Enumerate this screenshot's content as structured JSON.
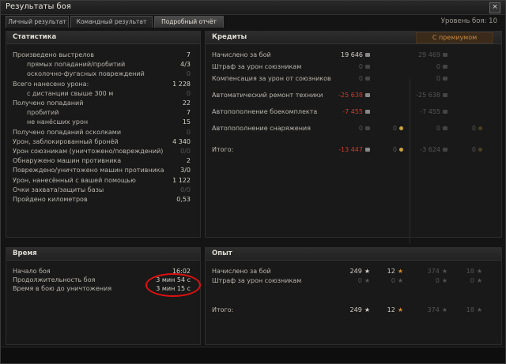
{
  "window": {
    "title": "Результаты боя",
    "close": "×"
  },
  "tabs": [
    {
      "label": "Личный результат"
    },
    {
      "label": "Командный результат"
    },
    {
      "label": "Подробный отчёт"
    }
  ],
  "level_label": "Уровень боя: 10",
  "stats": {
    "header": "Статистика",
    "rows": [
      {
        "label": "Произведено выстрелов",
        "value": "7",
        "indent": false,
        "dim": false
      },
      {
        "label": "прямых попаданий/пробитий",
        "value": "4/3",
        "indent": true,
        "dim": false
      },
      {
        "label": "осколочно-фугасных повреждений",
        "value": "0",
        "indent": true,
        "dim": true
      },
      {
        "label": "Всего нанесено урона:",
        "value": "1 228",
        "indent": false,
        "dim": false
      },
      {
        "label": "с дистанции свыше 300 м",
        "value": "0",
        "indent": true,
        "dim": true
      },
      {
        "label": "Получено попаданий",
        "value": "22",
        "indent": false,
        "dim": false
      },
      {
        "label": "пробитий",
        "value": "7",
        "indent": true,
        "dim": false
      },
      {
        "label": "не нанёсших урон",
        "value": "15",
        "indent": true,
        "dim": false
      },
      {
        "label": "Получено попаданий осколками",
        "value": "0",
        "indent": false,
        "dim": true
      },
      {
        "label": "Урон, заблокированный бронёй",
        "value": "4 340",
        "indent": false,
        "dim": false
      },
      {
        "label": "Урон союзникам (уничтожено/повреждений)",
        "value": "0/0",
        "indent": false,
        "dim": true
      },
      {
        "label": "Обнаружено машин противника",
        "value": "2",
        "indent": false,
        "dim": false
      },
      {
        "label": "Повреждено/уничтожено машин противника",
        "value": "3/0",
        "indent": false,
        "dim": false
      },
      {
        "label": "Урон, нанесённый с вашей помощью",
        "value": "1 122",
        "indent": false,
        "dim": false
      },
      {
        "label": "Очки захвата/защиты базы",
        "value": "0/0",
        "indent": false,
        "dim": true
      },
      {
        "label": "Пройдено километров",
        "value": "0,53",
        "indent": false,
        "dim": false
      }
    ]
  },
  "credits": {
    "header": "Кредиты",
    "premium_label": "С премиумом",
    "rows": [
      {
        "label": "Начислено за бой",
        "base": "19 646",
        "prem": "29 469",
        "red": false,
        "dim": false,
        "gold": false,
        "gap": 0
      },
      {
        "label": "Штраф за урон союзникам",
        "base": "0",
        "prem": "0",
        "red": false,
        "dim": true,
        "gold": false,
        "gap": 1
      },
      {
        "label": "Компенсация за урон от союзников",
        "base": "0",
        "prem": "0",
        "red": false,
        "dim": true,
        "gold": false,
        "gap": 1
      },
      {
        "label": "Автоматический ремонт техники",
        "base": "-25 638",
        "prem": "-25 638",
        "red": true,
        "dim": false,
        "gold": false,
        "gap": 3
      },
      {
        "label": "Автопополнение боекомплекта",
        "base": "-7 455",
        "prem": "-7 455",
        "red": true,
        "dim": false,
        "gold": false,
        "gap": 3
      },
      {
        "label": "Автопополнение снаряжения",
        "base": "0",
        "prem": "0",
        "gold_base": "0",
        "gold_prem": "0",
        "red": false,
        "dim": true,
        "gold": true,
        "gap": 3
      },
      {
        "label": "Итого:",
        "base": "-13 447",
        "prem": "-3 624",
        "gold_base": "0",
        "gold_prem": "0",
        "red": true,
        "dim": false,
        "gold": true,
        "gap": 5
      }
    ]
  },
  "time": {
    "header": "Время",
    "rows": [
      {
        "label": "Начало боя",
        "value": "16:02"
      },
      {
        "label": "Продолжительность боя",
        "value": "3 мин 54 с"
      },
      {
        "label": "Время в бою до уничтожения",
        "value": "3 мин 15 с"
      }
    ]
  },
  "experience": {
    "header": "Опыт",
    "rows": [
      {
        "label": "Начислено за бой",
        "xp": "249",
        "free": "12",
        "prem_xp": "374",
        "prem_free": "18",
        "dim": false
      },
      {
        "label": "Штраф за урон союзникам",
        "xp": "0",
        "free": "0",
        "prem_xp": "0",
        "prem_free": "0",
        "dim": true
      },
      {
        "label": "Итого:",
        "xp": "249",
        "free": "12",
        "prem_xp": "374",
        "prem_free": "18",
        "dim": false
      }
    ]
  },
  "colors": {
    "accent": "#c88a40",
    "negative": "#d23b2a",
    "highlight": "#e01010"
  }
}
